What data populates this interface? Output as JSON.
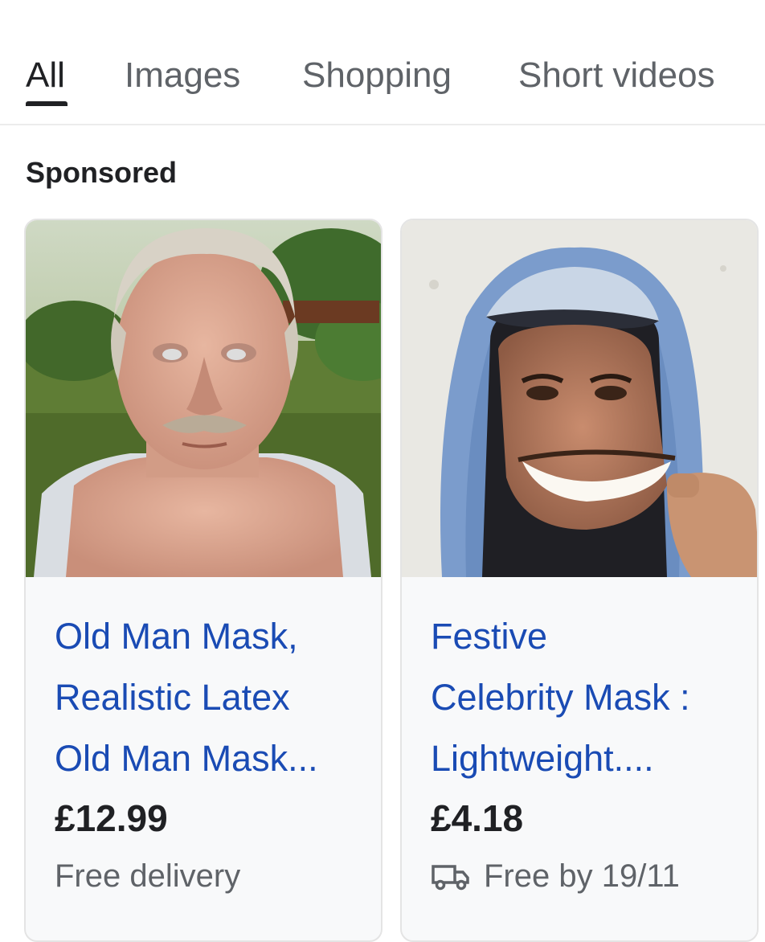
{
  "tabs": [
    {
      "label": "All",
      "active": true
    },
    {
      "label": "Images",
      "active": false
    },
    {
      "label": "Shopping",
      "active": false
    },
    {
      "label": "Short videos",
      "active": false
    }
  ],
  "section_label": "Sponsored",
  "products": [
    {
      "title_lines": [
        "Old Man Mask,",
        "Realistic Latex",
        "Old Man Mask..."
      ],
      "price": "£12.99",
      "delivery": "Free delivery",
      "delivery_icon": "none",
      "image": "old-man-mask-photo"
    },
    {
      "title_lines": [
        "Festive",
        "Celebrity Mask :",
        "Lightweight...."
      ],
      "price": "£4.18",
      "delivery": "Free by 19/11",
      "delivery_icon": "truck-icon",
      "image": "celebrity-mask-photo"
    }
  ],
  "colors": {
    "link_blue": "#1a4bb4",
    "text_dark": "#202124",
    "text_grey": "#5f6368",
    "card_bg": "#f8f9fa"
  }
}
